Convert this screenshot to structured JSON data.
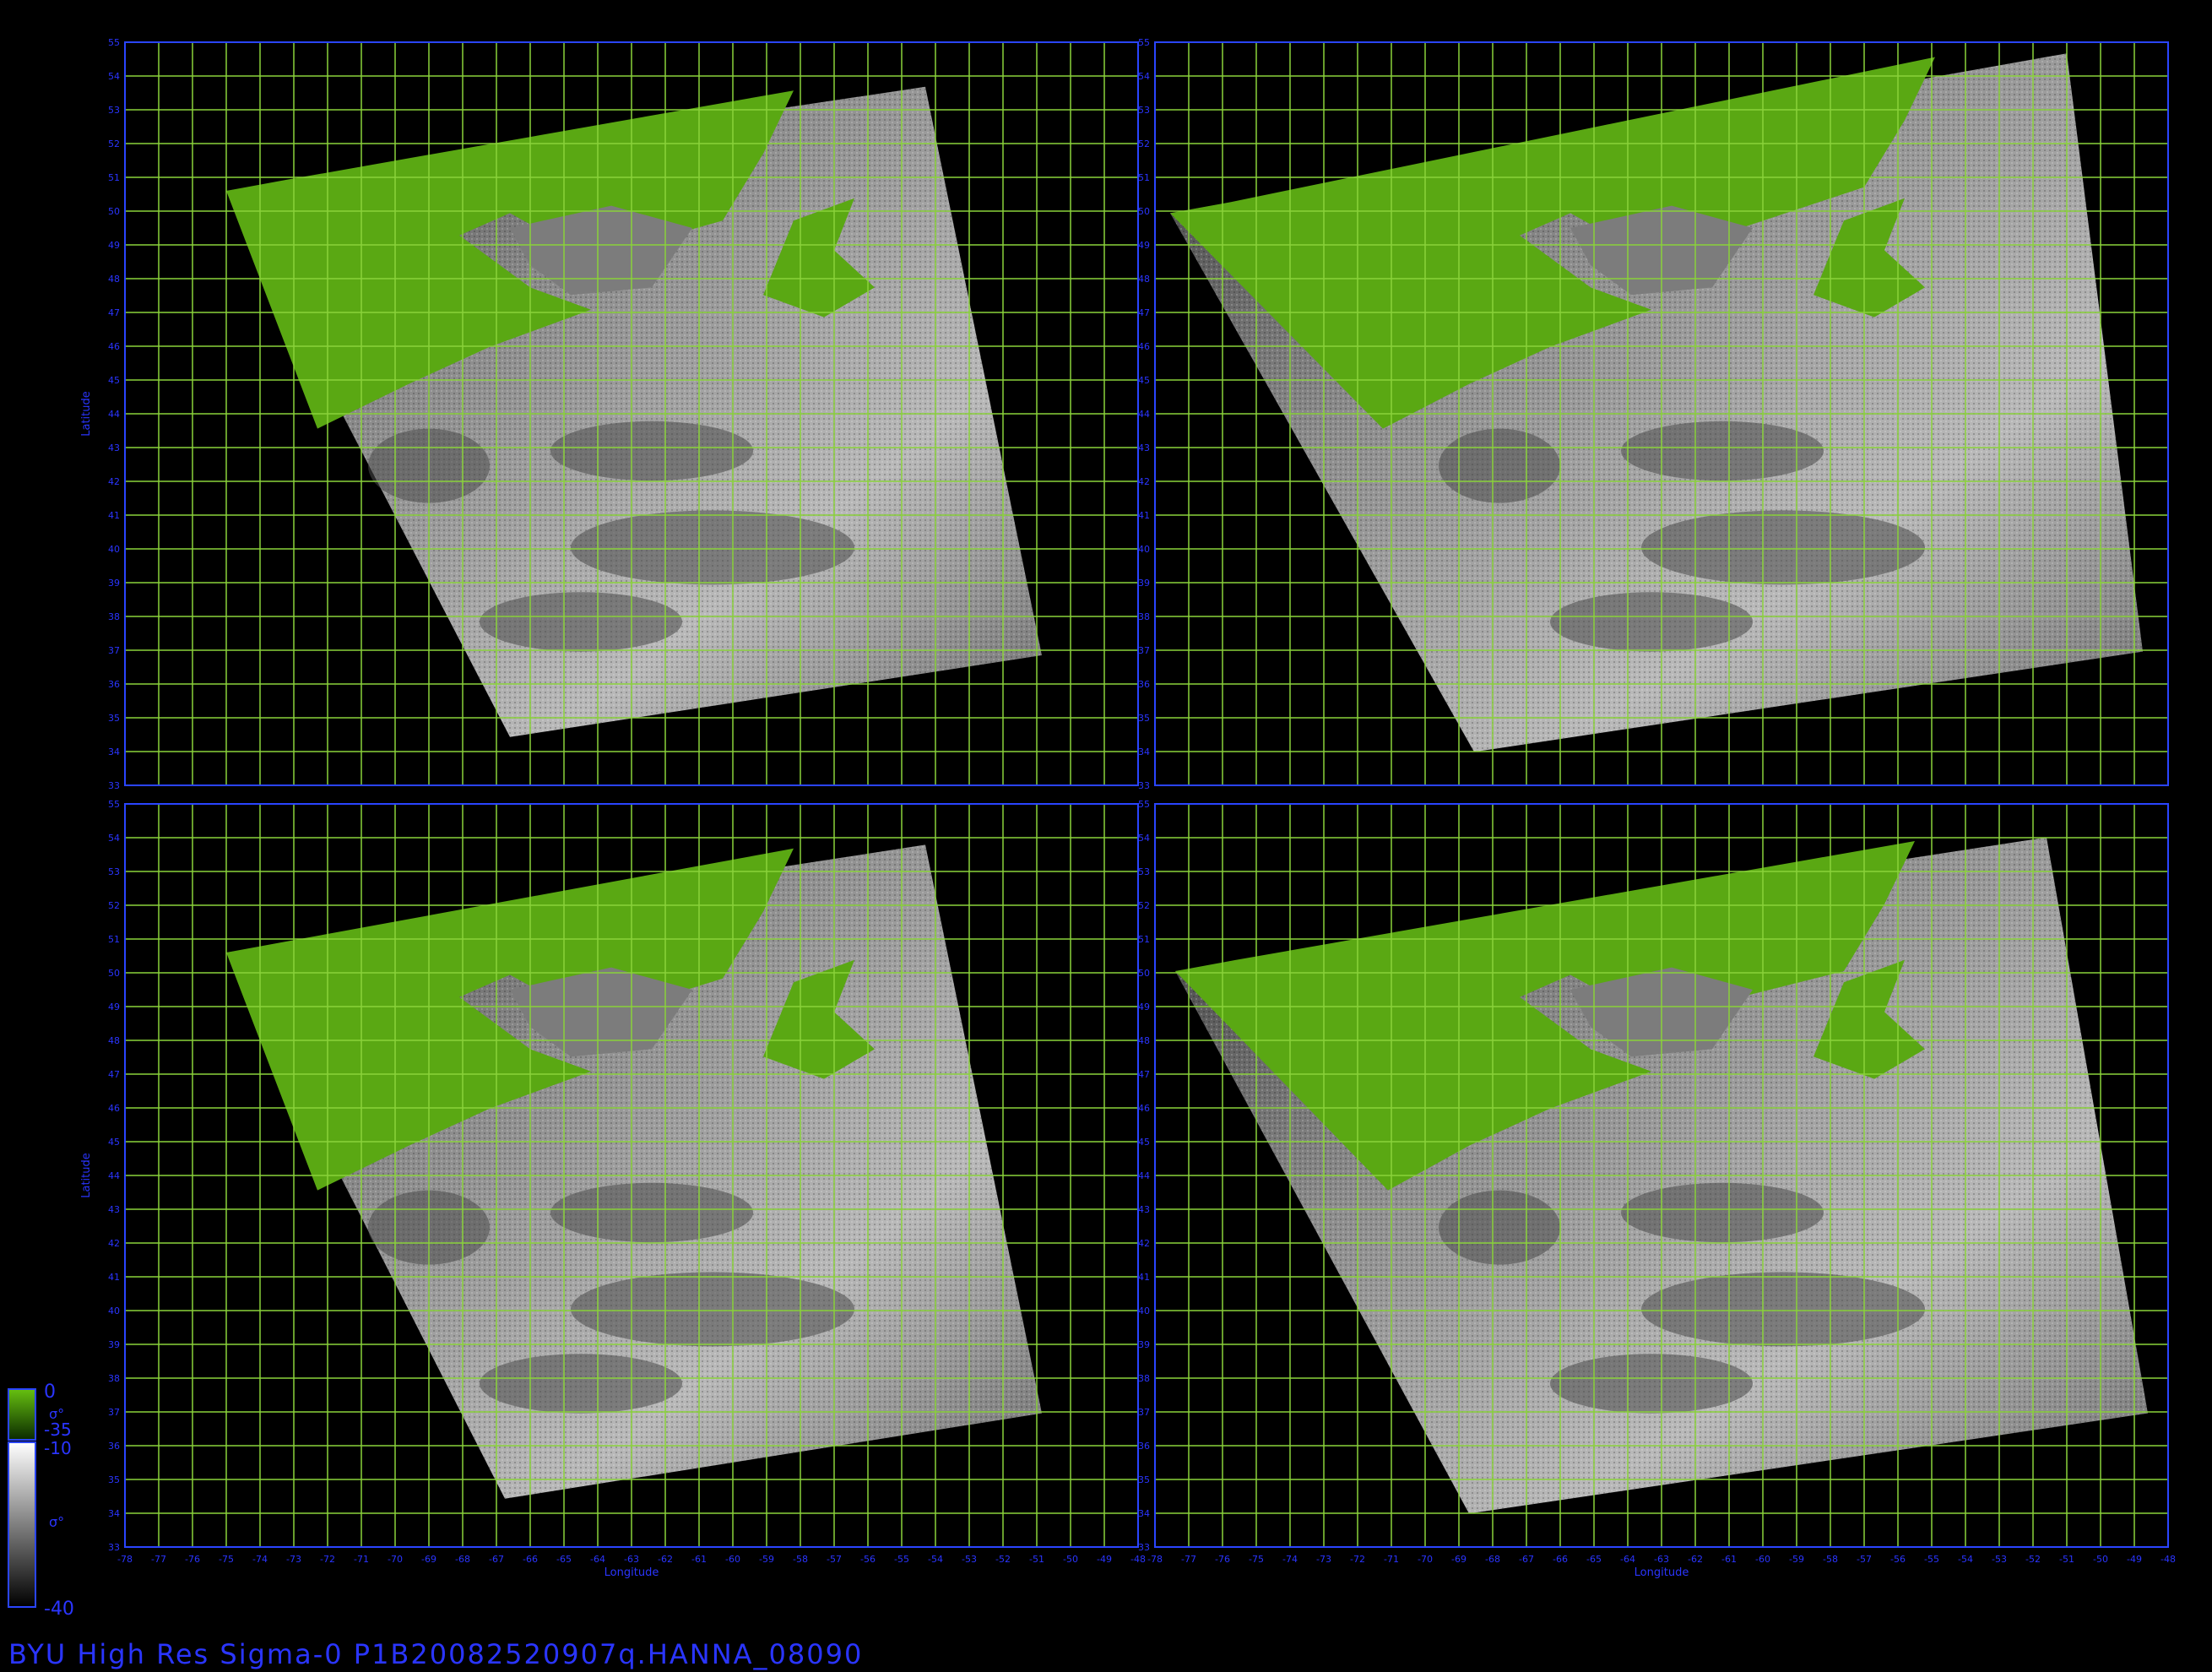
{
  "footer": {
    "caption": "BYU  High  Res  Sigma-0  P1B20082520907q.HANNA_08090"
  },
  "axes": {
    "xlabel": "Longitude",
    "ylabel": "Latitude",
    "lon_ticks": [
      "-78",
      "-77",
      "-76",
      "-75",
      "-74",
      "-73",
      "-72",
      "-71",
      "-70",
      "-69",
      "-68",
      "-67",
      "-66",
      "-65",
      "-64",
      "-63",
      "-62",
      "-61",
      "-60",
      "-59",
      "-58",
      "-57",
      "-56",
      "-55",
      "-54",
      "-53",
      "-52",
      "-51",
      "-50",
      "-49",
      "-48"
    ],
    "lat_ticks": [
      "33",
      "34",
      "35",
      "36",
      "37",
      "38",
      "39",
      "40",
      "41",
      "42",
      "43",
      "44",
      "45",
      "46",
      "47",
      "48",
      "49",
      "50",
      "51",
      "52",
      "53",
      "54",
      "55"
    ]
  },
  "colorbar": {
    "land_top": "0",
    "land_bottom": "-35",
    "land_symbol": "σ°",
    "ocean_top": "-10",
    "ocean_bottom": "-40",
    "ocean_symbol": "σ°"
  },
  "colors": {
    "background": "#000000",
    "grid": "#8ad23a",
    "frame": "#2a45ff",
    "axis_text": "#2a35ff",
    "land": "#5aa813"
  },
  "panels": [
    {
      "name": "panel-top-left"
    },
    {
      "name": "panel-top-right"
    },
    {
      "name": "panel-bottom-left"
    },
    {
      "name": "panel-bottom-right"
    }
  ]
}
